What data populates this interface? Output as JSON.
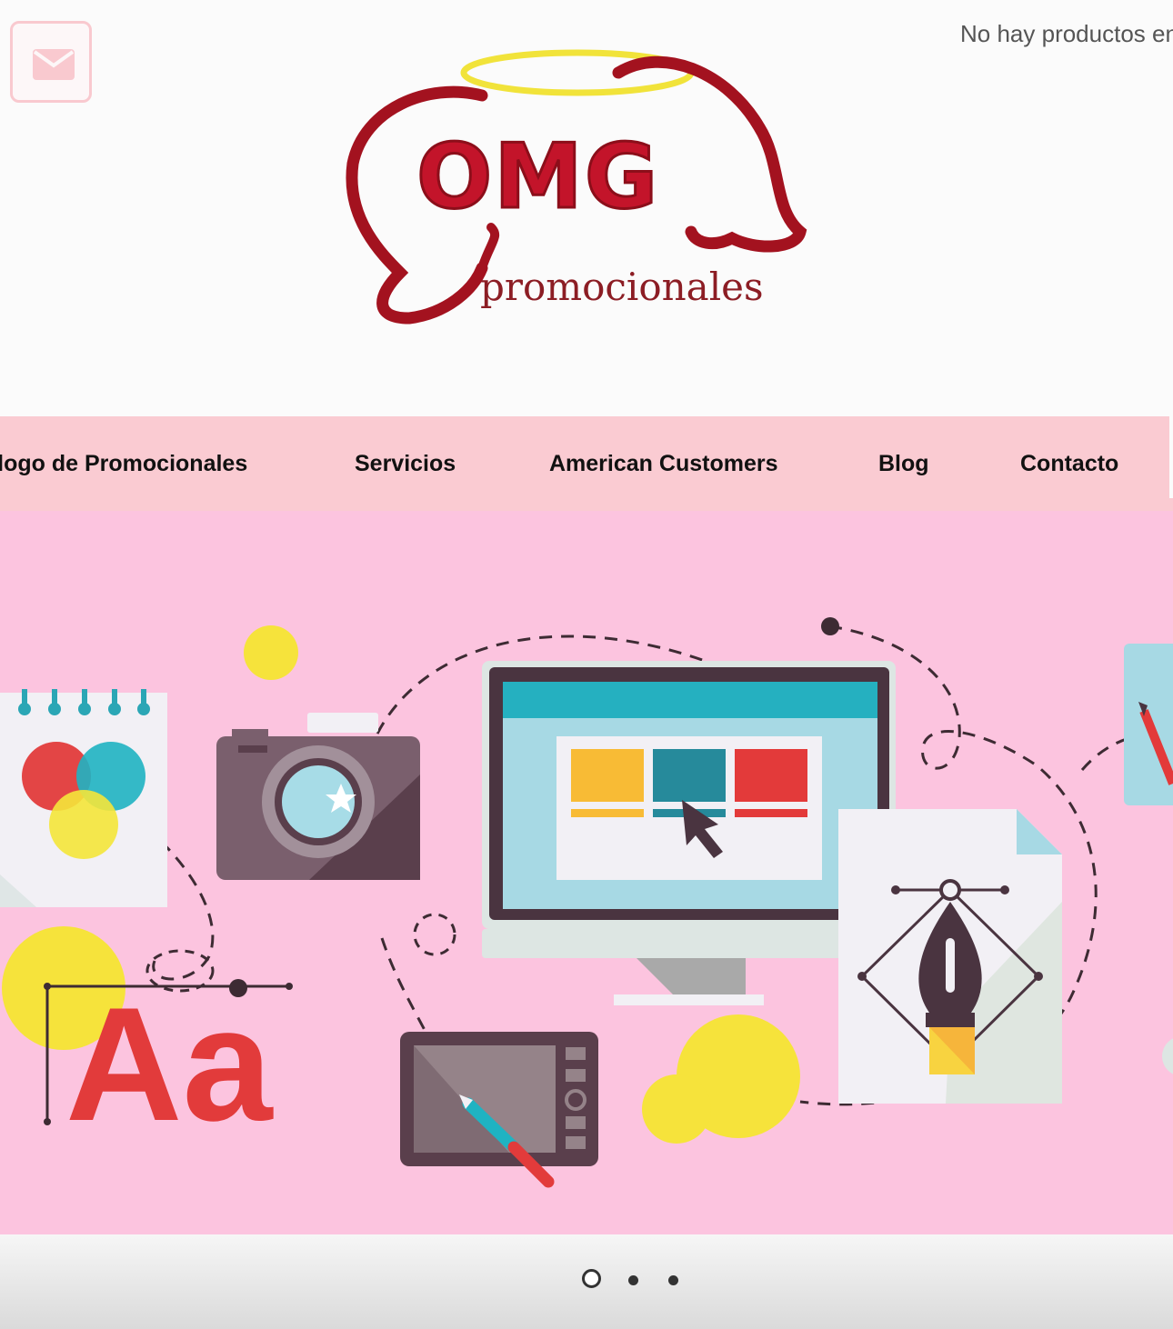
{
  "header": {
    "cart_text": "No hay productos en",
    "logo": {
      "main_text": "OMG",
      "sub_text": "promocionales"
    }
  },
  "nav": {
    "items": [
      {
        "label": "Catálogo de Promocionales"
      },
      {
        "label": "Servicios"
      },
      {
        "label": "American Customers"
      },
      {
        "label": "Blog"
      },
      {
        "label": "Contacto"
      }
    ]
  },
  "hero": {
    "typography_sample": "Aa",
    "background_color": "#fcc4df"
  },
  "slider": {
    "slide_count": 3,
    "active_slide": 1
  },
  "colors": {
    "nav_bg": "#facbd2",
    "logo_red": "#a3121f",
    "halo_yellow": "#f1e33a"
  },
  "icons": [
    "envelope-icon"
  ]
}
